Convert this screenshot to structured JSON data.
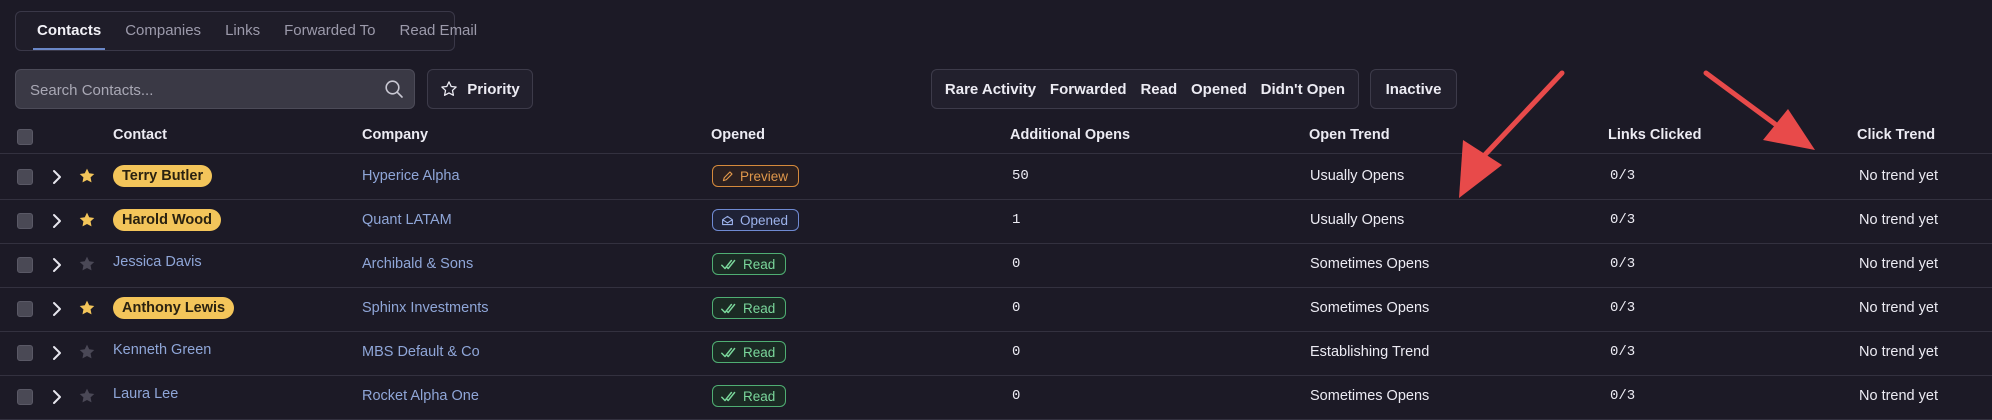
{
  "tabs": [
    "Contacts",
    "Companies",
    "Links",
    "Forwarded To",
    "Read Email"
  ],
  "search": {
    "placeholder": "Search Contacts..."
  },
  "priority_label": "Priority",
  "filters": [
    "Rare Activity",
    "Forwarded",
    "Read",
    "Opened",
    "Didn't Open"
  ],
  "inactive_label": "Inactive",
  "columns": {
    "contact": "Contact",
    "company": "Company",
    "opened": "Opened",
    "additional_opens": "Additional Opens",
    "open_trend": "Open Trend",
    "links_clicked": "Links Clicked",
    "click_trend": "Click Trend"
  },
  "rows": [
    {
      "name": "Terry Butler",
      "priority": true,
      "company": "Hyperice Alpha",
      "opened": "Preview",
      "opened_type": "preview",
      "additional_opens": "50",
      "open_trend": "Usually Opens",
      "links_clicked": "0/3",
      "click_trend": "No trend yet"
    },
    {
      "name": "Harold Wood",
      "priority": true,
      "company": "Quant LATAM",
      "opened": "Opened",
      "opened_type": "opened",
      "additional_opens": "1",
      "open_trend": "Usually Opens",
      "links_clicked": "0/3",
      "click_trend": "No trend yet"
    },
    {
      "name": "Jessica Davis",
      "priority": false,
      "company": "Archibald & Sons",
      "opened": "Read",
      "opened_type": "read",
      "additional_opens": "0",
      "open_trend": "Sometimes Opens",
      "links_clicked": "0/3",
      "click_trend": "No trend yet"
    },
    {
      "name": "Anthony Lewis",
      "priority": true,
      "company": "Sphinx Investments",
      "opened": "Read",
      "opened_type": "read",
      "additional_opens": "0",
      "open_trend": "Sometimes Opens",
      "links_clicked": "0/3",
      "click_trend": "No trend yet"
    },
    {
      "name": "Kenneth Green",
      "priority": false,
      "company": "MBS Default & Co",
      "opened": "Read",
      "opened_type": "read",
      "additional_opens": "0",
      "open_trend": "Establishing Trend",
      "links_clicked": "0/3",
      "click_trend": "No trend yet"
    },
    {
      "name": "Laura Lee",
      "priority": false,
      "company": "Rocket Alpha One",
      "opened": "Read",
      "opened_type": "read",
      "additional_opens": "0",
      "open_trend": "Sometimes Opens",
      "links_clicked": "0/3",
      "click_trend": "No trend yet"
    }
  ],
  "colors": {
    "background": "#1c1a26",
    "priority_pill": "#f3c55a",
    "star_active": "#f3c55a",
    "star_inactive": "#4a4856",
    "link_text": "#8fa6d8",
    "preview_badge": "#e0984b",
    "opened_badge": "#9db3ec",
    "read_badge": "#7ad79b",
    "annotation_arrow": "#e84a4a"
  },
  "icons": {
    "search": "search-icon",
    "priority": "star-outline-icon",
    "expand": "chevron-right-icon",
    "star": "star-icon",
    "preview": "pencil-icon",
    "opened": "envelope-open-icon",
    "read": "double-check-icon"
  }
}
